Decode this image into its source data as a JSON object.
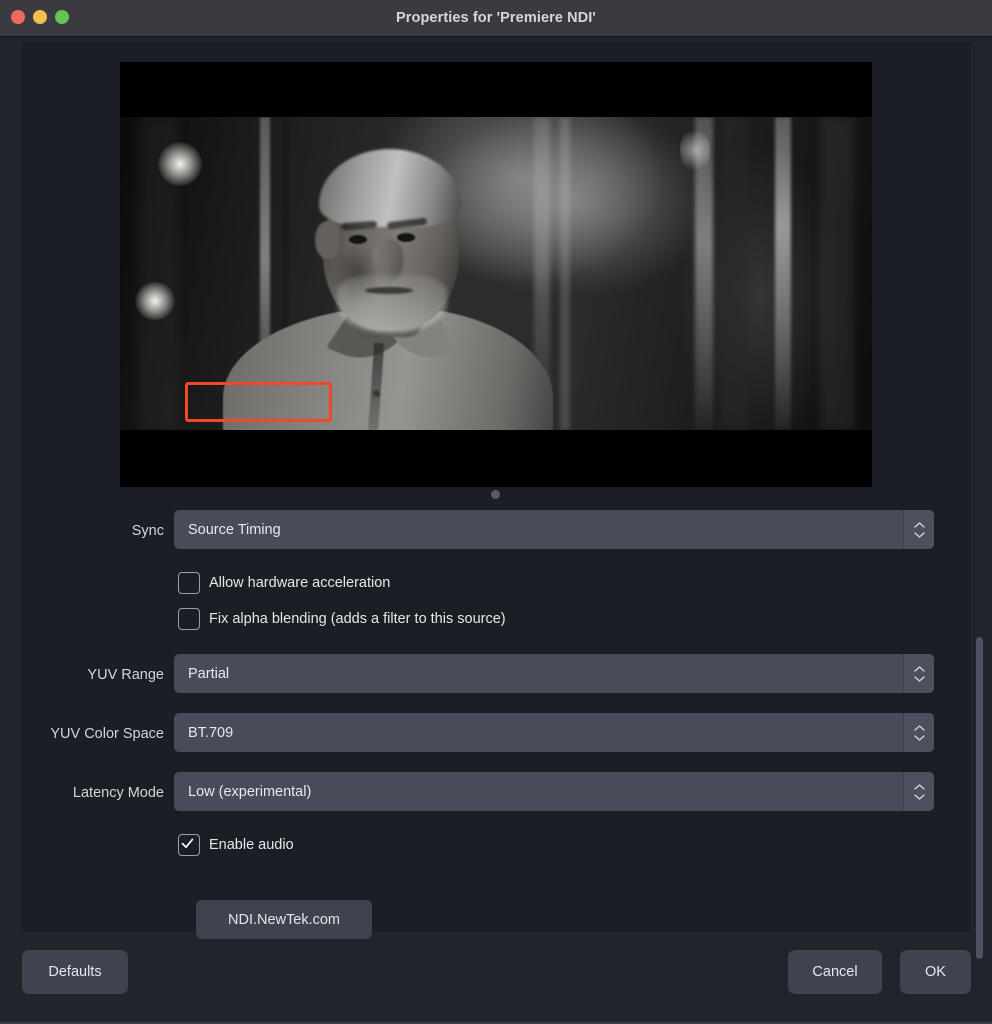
{
  "window": {
    "title": "Properties for 'Premiere NDI'",
    "traffic_lights": [
      {
        "name": "close",
        "color": "#ee6a5f"
      },
      {
        "name": "minimize",
        "color": "#f5bd4f"
      },
      {
        "name": "maximize",
        "color": "#61c454"
      }
    ]
  },
  "preview": {
    "description": "Letterboxed monochrome video frame: older man with grey hair and beard in a light collared shirt, standing in a dim room with lamps and bright vertical window light behind him",
    "page_dot_count": 1
  },
  "form": {
    "rows": [
      {
        "label": "Sync",
        "value": "Source Timing",
        "name": "sync"
      },
      {
        "label": "YUV Range",
        "value": "Partial",
        "name": "yuv-range"
      },
      {
        "label": "YUV Color Space",
        "value": "BT.709",
        "name": "yuv-color-space"
      },
      {
        "label": "Latency Mode",
        "value": "Low (experimental)",
        "name": "latency-mode"
      }
    ],
    "checkboxes": [
      {
        "label": "Allow hardware acceleration",
        "checked": false,
        "name": "allow-hardware-acceleration"
      },
      {
        "label": "Fix alpha blending (adds a filter to this source)",
        "checked": false,
        "name": "fix-alpha-blending"
      },
      {
        "label": "Enable audio",
        "checked": true,
        "name": "enable-audio"
      }
    ],
    "link_button": "NDI.NewTek.com"
  },
  "highlight": {
    "target": "Enable audio",
    "color": "#f0492a"
  },
  "footer": {
    "defaults": "Defaults",
    "cancel": "Cancel",
    "ok": "OK"
  },
  "colors": {
    "titlebar": "#3a3a40",
    "dialog_bg": "#21242b",
    "panel_bg": "#1b1e25",
    "field_bg": "#474b5a",
    "button_bg": "#3f4350",
    "text": "#e6e7ea",
    "highlight": "#f0492a"
  }
}
